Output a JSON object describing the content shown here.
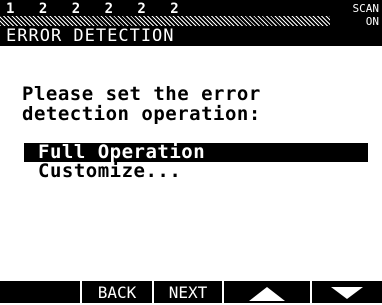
{
  "status": {
    "channels": "1 2 2 2 2 2",
    "scan_label": "SCAN",
    "scan_value": "ON"
  },
  "title": "ERROR DETECTION",
  "prompt": {
    "line1": "Please set the error",
    "line2": "detection operation:"
  },
  "options": [
    {
      "label": "Full Operation",
      "selected": true
    },
    {
      "label": "Customize...",
      "selected": false
    }
  ],
  "softkeys": {
    "back": "BACK",
    "next": "NEXT",
    "up_icon": "arrow-up-icon",
    "down_icon": "arrow-down-icon"
  },
  "colors": {
    "foreground": "#000000",
    "background": "#ffffff"
  }
}
